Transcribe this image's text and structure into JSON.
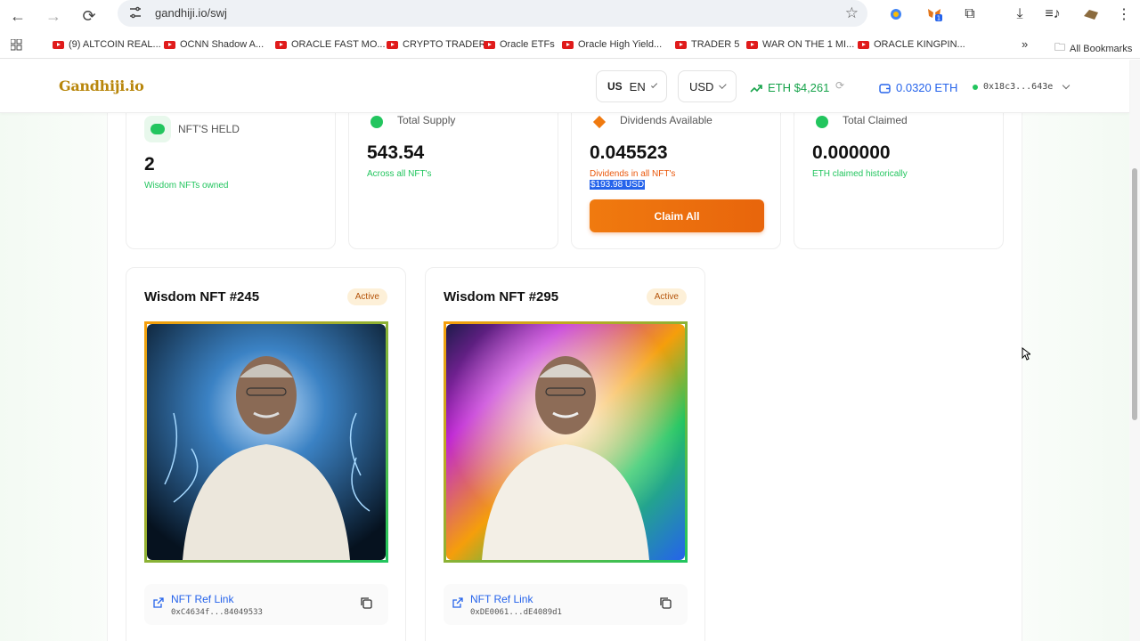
{
  "browser": {
    "url": "gandhiji.io/swj",
    "bookmarks": [
      "(9) ALTCOIN REAL...",
      "OCNN  Shadow A...",
      "ORACLE FAST MO...",
      "CRYPTO TRADER",
      "Oracle ETFs",
      "Oracle High Yield...",
      "TRADER 5",
      "WAR ON THE 1 MI...",
      "ORACLE KINGPIN..."
    ],
    "all_bookmarks": "All Bookmarks",
    "overflow": "»"
  },
  "header": {
    "logo": "Gandhiji.io",
    "lang_flag": "US",
    "lang": "EN",
    "currency": "USD",
    "eth_price": "ETH $4,261",
    "balance": "0.0320 ETH",
    "address": "0x18c3...643e"
  },
  "stats": [
    {
      "label": "NFT'S HELD",
      "value": "2",
      "sub": "Wisdom NFTs owned"
    },
    {
      "label": "Total Supply",
      "value": "543.54",
      "sub": "Across all NFT's"
    },
    {
      "label": "Dividends Available",
      "value": "0.045523",
      "sub": "Dividends in all NFT's",
      "usd": "$193.98 USD",
      "button": "Claim All"
    },
    {
      "label": "Total Claimed",
      "value": "0.000000",
      "sub": "ETH claimed historically"
    }
  ],
  "nfts": [
    {
      "title": "Wisdom NFT #245",
      "status": "Active",
      "ref_label": "NFT Ref Link",
      "ref_addr": "0xC4634f...84049533"
    },
    {
      "title": "Wisdom NFT #295",
      "status": "Active",
      "ref_label": "NFT Ref Link",
      "ref_addr": "0xDE0061...dE4089d1"
    }
  ],
  "colors": {
    "green": "#22c55e",
    "orange": "#f07a0f",
    "blue": "#2563eb",
    "gold": "#b8860b"
  }
}
